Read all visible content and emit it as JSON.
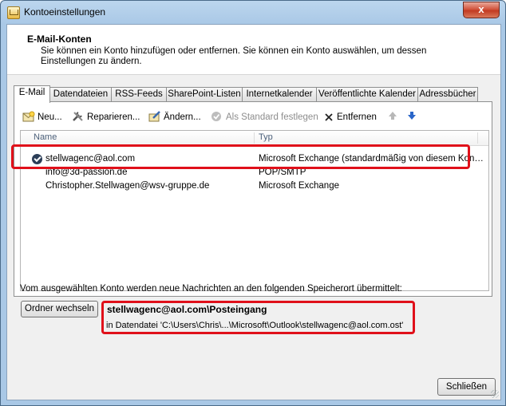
{
  "window": {
    "title": "Kontoeinstellungen",
    "close_label": "x"
  },
  "header": {
    "title": "E-Mail-Konten",
    "description": "Sie können ein Konto hinzufügen oder entfernen. Sie können ein Konto auswählen, um dessen Einstellungen zu ändern."
  },
  "tabs": [
    {
      "label": "E-Mail",
      "active": true
    },
    {
      "label": "Datendateien"
    },
    {
      "label": "RSS-Feeds"
    },
    {
      "label": "SharePoint-Listen"
    },
    {
      "label": "Internetkalender"
    },
    {
      "label": "Veröffentlichte Kalender"
    },
    {
      "label": "Adressbücher"
    }
  ],
  "toolbar": {
    "new_label": "Neu...",
    "repair_label": "Reparieren...",
    "change_label": "Ändern...",
    "set_default_label": "Als Standard festlegen",
    "remove_label": "Entfernen"
  },
  "accounts": {
    "columns": {
      "name": "Name",
      "type": "Typ"
    },
    "rows": [
      {
        "name": "stellwagenc@aol.com",
        "type": "Microsoft Exchange (standardmäßig von diesem Konto senden)",
        "default": true
      },
      {
        "name": "info@3d-passion.de",
        "type": "POP/SMTP"
      },
      {
        "name": "Christopher.Stellwagen@wsv-gruppe.de",
        "type": "Microsoft Exchange"
      }
    ]
  },
  "delivery": {
    "info": "Vom ausgewählten Konto werden neue Nachrichten an den folgenden Speicherort übermittelt:",
    "change_folder_label": "Ordner wechseln",
    "folder_name": "stellwagenc@aol.com\\Posteingang",
    "folder_path": "in Datendatei 'C:\\Users\\Chris\\...\\Microsoft\\Outlook\\stellwagenc@aol.com.ost'"
  },
  "footer": {
    "close_label": "Schließen"
  },
  "colors": {
    "highlight": "#e0101a",
    "arrow_active": "#2a66c9"
  }
}
